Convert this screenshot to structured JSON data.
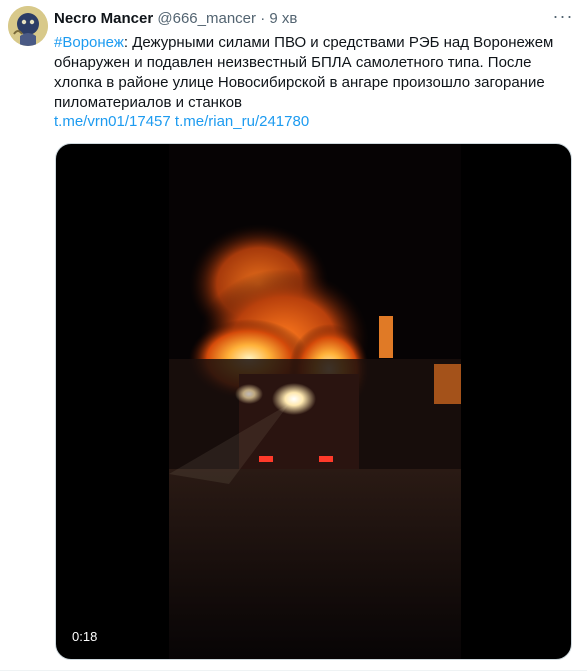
{
  "tweet": {
    "author": {
      "name": "Necro Mancer",
      "handle": "@666_mancer",
      "separator": "·",
      "time": "9 хв"
    },
    "more_label": "···",
    "hashtag": "#Воронеж",
    "body": ": Дежурными силами ПВО и средствами РЭБ над Воронежем обнаружен и подавлен неизвестный БПЛА самолетного типа. После хлопка в районе улице Новосибирской в ангаре произошло загорание пиломатериалов и станков",
    "links": [
      "t.me/vrn01/17457",
      "t.me/rian_ru/241780"
    ],
    "video": {
      "duration": "0:18"
    }
  }
}
